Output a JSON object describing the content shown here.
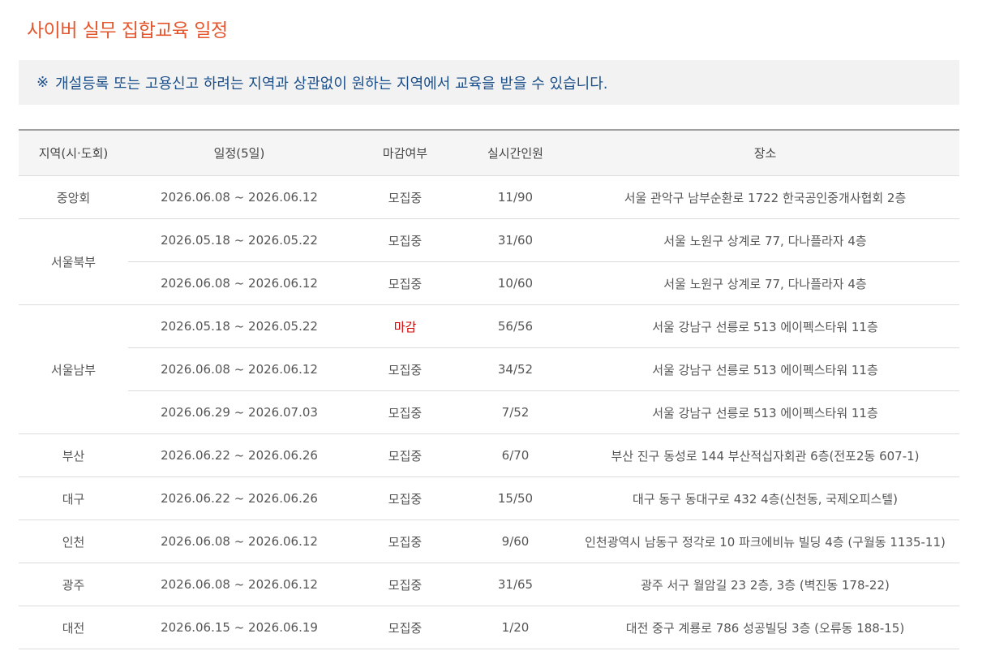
{
  "title": "사이버 실무 집합교육 일정",
  "notice": {
    "mark": "※",
    "text": "개설등록 또는 고용신고 하려는 지역과 상관없이 원하는 지역에서 교육을 받을 수 있습니다."
  },
  "table": {
    "headers": [
      "지역(시·도회)",
      "일정(5일)",
      "마감여부",
      "실시간인원",
      "장소"
    ],
    "regions": [
      {
        "name": "중앙회",
        "rows": [
          {
            "date": "2026.06.08 ~ 2026.06.12",
            "status": "모집중",
            "count": "11/90",
            "place": "서울 관악구 남부순환로 1722 한국공인중개사협회 2층"
          }
        ]
      },
      {
        "name": "서울북부",
        "rows": [
          {
            "date": "2026.05.18 ~ 2026.05.22",
            "status": "모집중",
            "count": "31/60",
            "place": "서울 노원구 상계로 77, 다나플라자 4층"
          },
          {
            "date": "2026.06.08 ~ 2026.06.12",
            "status": "모집중",
            "count": "10/60",
            "place": "서울 노원구 상계로 77, 다나플라자 4층"
          }
        ]
      },
      {
        "name": "서울남부",
        "rows": [
          {
            "date": "2026.05.18 ~ 2026.05.22",
            "status": "마감",
            "count": "56/56",
            "place": "서울 강남구 선릉로 513 에이펙스타워 11층"
          },
          {
            "date": "2026.06.08 ~ 2026.06.12",
            "status": "모집중",
            "count": "34/52",
            "place": "서울 강남구 선릉로 513 에이펙스타워 11층"
          },
          {
            "date": "2026.06.29 ~ 2026.07.03",
            "status": "모집중",
            "count": "7/52",
            "place": "서울 강남구 선릉로 513 에이펙스타워 11층"
          }
        ]
      },
      {
        "name": "부산",
        "rows": [
          {
            "date": "2026.06.22 ~ 2026.06.26",
            "status": "모집중",
            "count": "6/70",
            "place": "부산 진구 동성로 144 부산적십자회관 6층(전포2동 607-1)"
          }
        ]
      },
      {
        "name": "대구",
        "rows": [
          {
            "date": "2026.06.22 ~ 2026.06.26",
            "status": "모집중",
            "count": "15/50",
            "place": "대구 동구 동대구로 432 4층(신천동, 국제오피스텔)"
          }
        ]
      },
      {
        "name": "인천",
        "rows": [
          {
            "date": "2026.06.08 ~ 2026.06.12",
            "status": "모집중",
            "count": "9/60",
            "place": "인천광역시 남동구 정각로 10 파크에비뉴 빌딩 4층 (구월동 1135-11)"
          }
        ]
      },
      {
        "name": "광주",
        "rows": [
          {
            "date": "2026.06.08 ~ 2026.06.12",
            "status": "모집중",
            "count": "31/65",
            "place": "광주 서구 월암길 23 2층, 3층 (벽진동 178-22)"
          }
        ]
      },
      {
        "name": "대전",
        "rows": [
          {
            "date": "2026.06.15 ~ 2026.06.19",
            "status": "모집중",
            "count": "1/20",
            "place": "대전 중구 계룡로 786 성공빌딩 3층 (오류동 188-15)"
          }
        ]
      }
    ]
  },
  "colors": {
    "title": "#e4572e",
    "notice_text": "#1a4f8a",
    "closed_status": "#d00000"
  }
}
